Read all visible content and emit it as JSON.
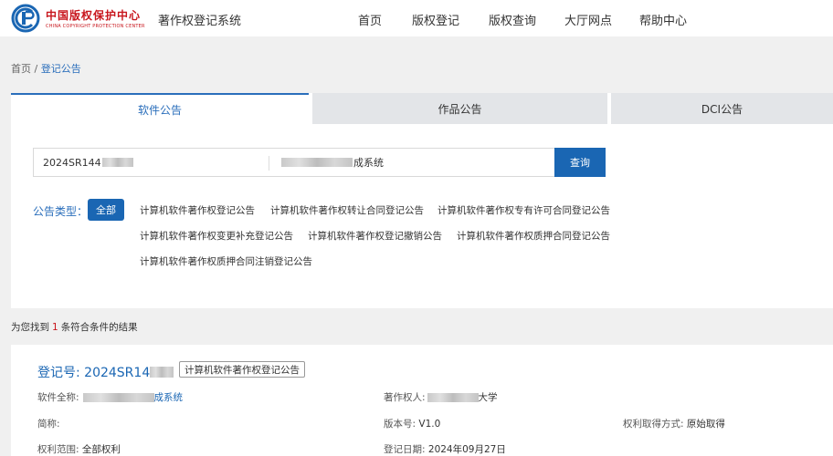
{
  "header": {
    "logo_cn": "中国版权保护中心",
    "logo_en": "CHINA COPYRIGHT PROTECTION CENTER",
    "system_title": "著作权登记系统",
    "nav": [
      "首页",
      "版权登记",
      "版权查询",
      "大厅网点",
      "帮助中心"
    ]
  },
  "breadcrumb": {
    "home": "首页",
    "sep": "/",
    "current": "登记公告"
  },
  "tabs": [
    "软件公告",
    "作品公告",
    "DCI公告"
  ],
  "search": {
    "reg_no_value": "2024SR144",
    "name_suffix": "成系统",
    "button": "查询"
  },
  "types": {
    "label": "公告类型：",
    "all": "全部",
    "options": [
      "计算机软件著作权登记公告",
      "计算机软件著作权转让合同登记公告",
      "计算机软件著作权专有许可合同登记公告",
      "计算机软件著作权变更补充登记公告",
      "计算机软件著作权登记撤销公告",
      "计算机软件著作权质押合同登记公告",
      "计算机软件著作权质押合同注销登记公告"
    ]
  },
  "result": {
    "prefix": "为您找到",
    "count": "1",
    "suffix": "条符合条件的结果"
  },
  "card": {
    "reg_label": "登记号: 2024SR14",
    "badge": "计算机软件著作权登记公告",
    "full_name_label": "软件全称:",
    "full_name_suffix": "成系统",
    "owner_label": "著作权人:",
    "owner_suffix": "大学",
    "short_name_label": "简称:",
    "version_label": "版本号:",
    "version_value": "V1.0",
    "acquire_label": "权利取得方式:",
    "acquire_value": "原始取得",
    "scope_label": "权利范围:",
    "scope_value": "全部权利",
    "date_label": "登记日期:",
    "date_value": "2024年09月27日"
  }
}
